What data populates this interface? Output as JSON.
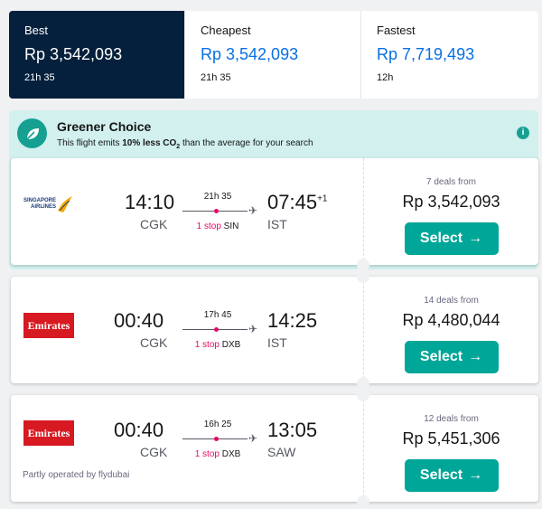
{
  "tabs": [
    {
      "label": "Best",
      "price": "Rp 3,542,093",
      "duration": "21h 35"
    },
    {
      "label": "Cheapest",
      "price": "Rp 3,542,093",
      "duration": "21h 35"
    },
    {
      "label": "Fastest",
      "price": "Rp 7,719,493",
      "duration": "12h"
    }
  ],
  "greener": {
    "title": "Greener Choice",
    "sub_prefix": "This flight emits ",
    "sub_bold": "10% less CO",
    "sub_subscript": "2",
    "sub_suffix": " than the average for your search",
    "info_glyph": "i",
    "icon": "leaf-icon"
  },
  "flights": [
    {
      "airline": "Singapore Airlines",
      "logo_text_1": "SINGAPORE",
      "logo_text_2": "AIRLINES",
      "depart_time": "14:10",
      "depart_code": "CGK",
      "arrive_time": "07:45",
      "arrive_offset": "+1",
      "arrive_code": "IST",
      "duration": "21h 35",
      "stops": "1 stop",
      "via": "SIN",
      "deals": "7 deals from",
      "price": "Rp 3,542,093",
      "select": "Select"
    },
    {
      "airline": "Emirates",
      "logo_text": "Emirates",
      "depart_time": "00:40",
      "depart_code": "CGK",
      "arrive_time": "14:25",
      "arrive_offset": "",
      "arrive_code": "IST",
      "duration": "17h 45",
      "stops": "1 stop",
      "via": "DXB",
      "deals": "14 deals from",
      "price": "Rp 4,480,044",
      "select": "Select"
    },
    {
      "airline": "Emirates",
      "logo_text": "Emirates",
      "depart_time": "00:40",
      "depart_code": "CGK",
      "arrive_time": "13:05",
      "arrive_offset": "",
      "arrive_code": "SAW",
      "duration": "16h 25",
      "stops": "1 stop",
      "via": "DXB",
      "note": "Partly operated by flydubai",
      "deals": "12 deals from",
      "price": "Rp 5,451,306",
      "select": "Select"
    }
  ],
  "colors": {
    "accent": "#00a698",
    "active_tab": "#05203c",
    "price_blue": "#0770e3",
    "stop_red": "#e70866",
    "green_bg": "#d1f0ee"
  }
}
